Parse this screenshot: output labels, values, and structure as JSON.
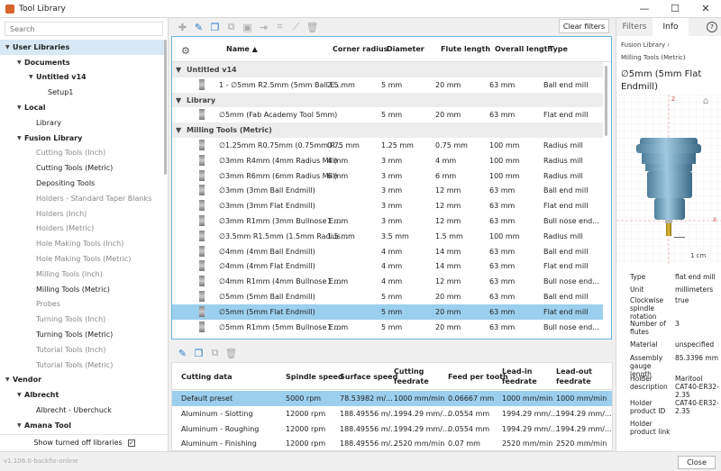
{
  "window": {
    "title": "Tool Library",
    "minimize": "—",
    "maximize": "☐",
    "close": "✕"
  },
  "left": {
    "search_placeholder": "Search",
    "tree": [
      {
        "label": "User Libraries",
        "indent": 0,
        "tri": "▼",
        "style": "bold",
        "sel": true
      },
      {
        "label": "Documents",
        "indent": 1,
        "tri": "▼",
        "style": "bold"
      },
      {
        "label": "Untitled v14",
        "indent": 2,
        "tri": "▼",
        "style": "bold"
      },
      {
        "label": "Setup1",
        "indent": 3,
        "tri": "",
        "style": ""
      },
      {
        "label": "Local",
        "indent": 1,
        "tri": "▼",
        "style": "bold"
      },
      {
        "label": "Library",
        "indent": 2,
        "tri": "",
        "style": ""
      },
      {
        "label": "Fusion Library",
        "indent": 1,
        "tri": "▼",
        "style": "bold"
      },
      {
        "label": "Cutting Tools (Inch)",
        "indent": 2,
        "tri": "",
        "style": "grey"
      },
      {
        "label": "Cutting Tools (Metric)",
        "indent": 2,
        "tri": "",
        "style": ""
      },
      {
        "label": "Depositing Tools",
        "indent": 2,
        "tri": "",
        "style": ""
      },
      {
        "label": "Holders - Standard Taper Blanks",
        "indent": 2,
        "tri": "",
        "style": "grey"
      },
      {
        "label": "Holders (Inch)",
        "indent": 2,
        "tri": "",
        "style": "grey"
      },
      {
        "label": "Holders (Metric)",
        "indent": 2,
        "tri": "",
        "style": "grey"
      },
      {
        "label": "Hole Making Tools (Inch)",
        "indent": 2,
        "tri": "",
        "style": "grey"
      },
      {
        "label": "Hole Making Tools (Metric)",
        "indent": 2,
        "tri": "",
        "style": "grey"
      },
      {
        "label": "Milling Tools (Inch)",
        "indent": 2,
        "tri": "",
        "style": "grey"
      },
      {
        "label": "Milling Tools (Metric)",
        "indent": 2,
        "tri": "",
        "style": ""
      },
      {
        "label": "Probes",
        "indent": 2,
        "tri": "",
        "style": "grey"
      },
      {
        "label": "Turning Tools (Inch)",
        "indent": 2,
        "tri": "",
        "style": "grey"
      },
      {
        "label": "Turning Tools (Metric)",
        "indent": 2,
        "tri": "",
        "style": ""
      },
      {
        "label": "Tutorial Tools (Inch)",
        "indent": 2,
        "tri": "",
        "style": "grey"
      },
      {
        "label": "Tutorial Tools (Metric)",
        "indent": 2,
        "tri": "",
        "style": "grey"
      },
      {
        "label": "Vendor",
        "indent": 0,
        "tri": "▼",
        "style": "bold"
      },
      {
        "label": "Albrecht",
        "indent": 1,
        "tri": "▼",
        "style": "bold"
      },
      {
        "label": "Albrecht - Uberchuck",
        "indent": 2,
        "tri": "",
        "style": ""
      },
      {
        "label": "Amana Tool",
        "indent": 1,
        "tri": "▼",
        "style": "bold"
      }
    ],
    "show_off_label": "Show turned off libraries",
    "show_off_checked": "✓"
  },
  "toolbar": {
    "clear_filters": "Clear filters"
  },
  "grid": {
    "headers": {
      "name": "Name",
      "sort": "▲",
      "corner": "Corner radius",
      "diameter": "Diameter",
      "flute": "Flute length",
      "overall": "Overall length",
      "type": "Type"
    },
    "rows": [
      {
        "group": "Untitled v14"
      },
      {
        "name": "1 - ∅5mm R2.5mm (5mm Ball E...",
        "corner": "2.5 mm",
        "diameter": "5 mm",
        "flute": "20 mm",
        "overall": "63 mm",
        "type": "Ball end mill"
      },
      {
        "group": "Library"
      },
      {
        "name": "∅5mm (Fab Academy Tool 5mm)",
        "corner": "",
        "diameter": "5 mm",
        "flute": "20 mm",
        "overall": "63 mm",
        "type": "Flat end mill"
      },
      {
        "group": "Milling Tools (Metric)"
      },
      {
        "name": "∅1.25mm R0.75mm (0.75mm R...",
        "corner": "0.75 mm",
        "diameter": "1.25 mm",
        "flute": "0.75 mm",
        "overall": "100 mm",
        "type": "Radius mill"
      },
      {
        "name": "∅3mm R4mm (4mm Radius Mill)",
        "corner": "4 mm",
        "diameter": "3 mm",
        "flute": "4 mm",
        "overall": "100 mm",
        "type": "Radius mill"
      },
      {
        "name": "∅3mm R6mm (6mm Radius Mill)",
        "corner": "6 mm",
        "diameter": "3 mm",
        "flute": "6 mm",
        "overall": "100 mm",
        "type": "Radius mill"
      },
      {
        "name": "∅3mm (3mm Ball Endmill)",
        "corner": "",
        "diameter": "3 mm",
        "flute": "12 mm",
        "overall": "63 mm",
        "type": "Ball end mill"
      },
      {
        "name": "∅3mm (3mm Flat Endmill)",
        "corner": "",
        "diameter": "3 mm",
        "flute": "12 mm",
        "overall": "63 mm",
        "type": "Flat end mill"
      },
      {
        "name": "∅3mm R1mm (3mm Bullnose E...",
        "corner": "1 mm",
        "diameter": "3 mm",
        "flute": "12 mm",
        "overall": "63 mm",
        "type": "Bull nose end..."
      },
      {
        "name": "∅3.5mm R1.5mm (1.5mm Radius...",
        "corner": "1.5 mm",
        "diameter": "3.5 mm",
        "flute": "1.5 mm",
        "overall": "100 mm",
        "type": "Radius mill"
      },
      {
        "name": "∅4mm (4mm Ball Endmill)",
        "corner": "",
        "diameter": "4 mm",
        "flute": "14 mm",
        "overall": "63 mm",
        "type": "Ball end mill"
      },
      {
        "name": "∅4mm (4mm Flat Endmill)",
        "corner": "",
        "diameter": "4 mm",
        "flute": "14 mm",
        "overall": "63 mm",
        "type": "Flat end mill"
      },
      {
        "name": "∅4mm R1mm (4mm Bullnose E...",
        "corner": "1 mm",
        "diameter": "4 mm",
        "flute": "12 mm",
        "overall": "63 mm",
        "type": "Bull nose end..."
      },
      {
        "name": "∅5mm (5mm Ball Endmill)",
        "corner": "",
        "diameter": "5 mm",
        "flute": "20 mm",
        "overall": "63 mm",
        "type": "Ball end mill"
      },
      {
        "name": "∅5mm (5mm Flat Endmill)",
        "corner": "",
        "diameter": "5 mm",
        "flute": "20 mm",
        "overall": "63 mm",
        "type": "Flat end mill",
        "sel": true
      },
      {
        "name": "∅5mm R1mm (5mm Bullnose E...",
        "corner": "1 mm",
        "diameter": "5 mm",
        "flute": "20 mm",
        "overall": "63 mm",
        "type": "Bull nose end..."
      }
    ]
  },
  "presets": {
    "headers": {
      "cutting": "Cutting data",
      "spindle": "Spindle speed",
      "surface": "Surface speed",
      "cfeed": "Cutting feedrate",
      "fpt": "Feed per tooth",
      "lead_in": "Lead-in feedrate",
      "lead_out": "Lead-out feedrate"
    },
    "rows": [
      {
        "cutting": "Default preset",
        "spindle": "5000 rpm",
        "surface": "78.53982 m/...",
        "cfeed": "1000 mm/min",
        "fpt": "0.06667 mm",
        "lead_in": "1000 mm/min",
        "lead_out": "1000 mm/min",
        "sel": true
      },
      {
        "cutting": "Aluminum - Slotting",
        "spindle": "12000 rpm",
        "surface": "188.49556 m/...",
        "cfeed": "1994.29 mm/...",
        "fpt": "0.0554 mm",
        "lead_in": "1994.29 mm/...",
        "lead_out": "1994.29 mm/..."
      },
      {
        "cutting": "Aluminum - Roughing",
        "spindle": "12000 rpm",
        "surface": "188.49556 m/...",
        "cfeed": "1994.29 mm/...",
        "fpt": "0.0554 mm",
        "lead_in": "1994.29 mm/...",
        "lead_out": "1994.29 mm/..."
      },
      {
        "cutting": "Aluminum - Finishing",
        "spindle": "12000 rpm",
        "surface": "188.49556 m/...",
        "cfeed": "2520 mm/min",
        "fpt": "0.07 mm",
        "lead_in": "2520 mm/min",
        "lead_out": "2520 mm/min"
      }
    ]
  },
  "right": {
    "tab_filters": "Filters",
    "tab_info": "Info",
    "help": "?",
    "crumb1": "Fusion Library  ›",
    "crumb2": "Milling Tools (Metric)",
    "name": "∅5mm (5mm Flat Endmill)",
    "axis_z": "Z",
    "axis_x": "X",
    "scale": "1 cm",
    "props": [
      {
        "k": "Type",
        "v": "flat end mill"
      },
      {
        "k": "Unit",
        "v": "millimeters"
      },
      {
        "k": "Clockwise spindle rotation",
        "v": "true"
      },
      {
        "k": "Number of flutes",
        "v": "3"
      },
      {
        "k": "Material",
        "v": "unspecified"
      },
      {
        "k": "Assembly gauge length",
        "v": "85.3396 mm"
      },
      {
        "k": "Holder description",
        "v": "Maritool CAT40-ER32-2.35"
      },
      {
        "k": "Holder product ID",
        "v": "CAT40-ER32-2.35"
      },
      {
        "k": "Holder product link",
        "v": ""
      }
    ]
  },
  "status": {
    "version": "v1.106.0-backfix-online",
    "close": "Close"
  }
}
